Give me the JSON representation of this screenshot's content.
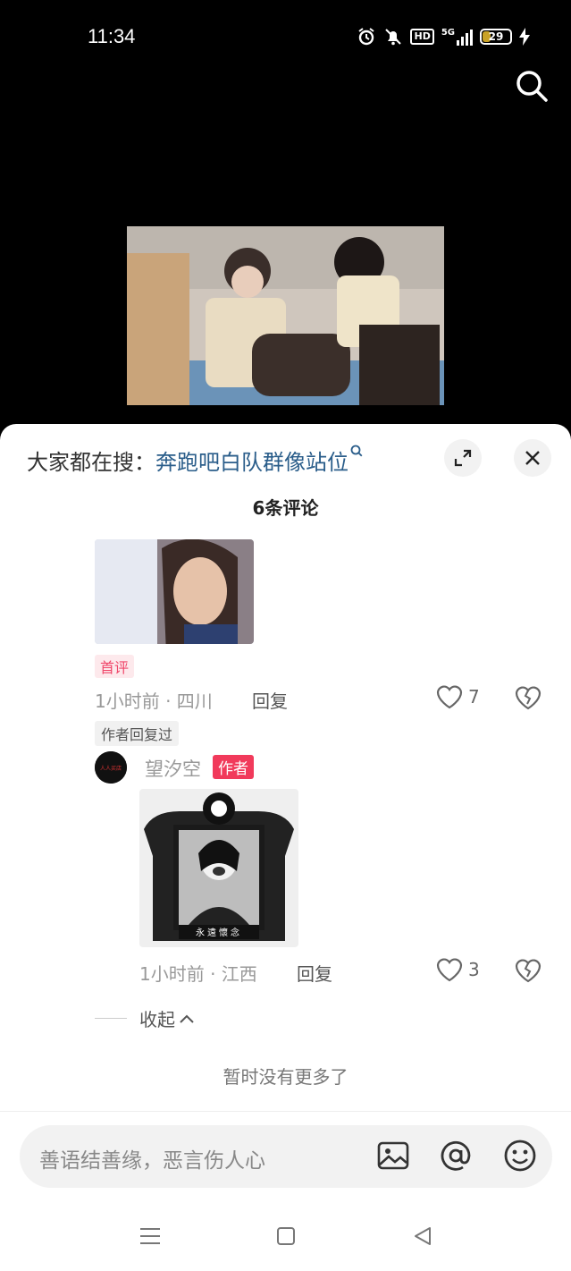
{
  "status_bar": {
    "time": "11:34",
    "network": "5G",
    "battery": "29",
    "hd": "HD"
  },
  "hot_search": {
    "label": "大家都在搜：",
    "keyword": "奔跑吧白队群像站位"
  },
  "comments_header": {
    "count_text": "6条评论"
  },
  "comment_1": {
    "badge": "首评",
    "time_location": "1小时前 · 四川",
    "reply_label": "回复",
    "likes": "7",
    "author_replied": "作者回复过"
  },
  "reply_1": {
    "username": "望汐空",
    "author_tag": "作者",
    "avatar_text": "人人买店",
    "time_location": "1小时前 · 江西",
    "reply_label": "回复",
    "likes": "3",
    "frame_caption": "永遠懷念"
  },
  "collapse_label": "收起",
  "no_more_text": "暂时没有更多了",
  "input": {
    "placeholder": "善语结善缘，恶言伤人心"
  },
  "colors": {
    "accent": "#f13a5b",
    "link": "#2a5d8a",
    "badge_bg": "#fde9ec"
  },
  "icons": [
    "search-icon",
    "expand-icon",
    "close-icon",
    "heart-icon",
    "broken-heart-icon",
    "image-icon",
    "at-icon",
    "emoji-icon",
    "menu-icon",
    "home-icon",
    "back-icon"
  ]
}
